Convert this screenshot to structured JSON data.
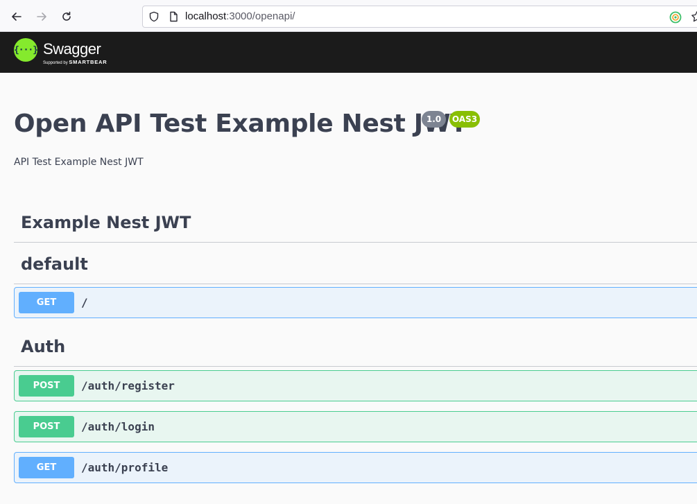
{
  "browser": {
    "url_host": "localhost",
    "url_path": ":3000/openapi/",
    "icons": [
      "back-arrow-icon",
      "forward-arrow-icon",
      "reload-icon",
      "shield-icon",
      "page-icon",
      "extension-icon",
      "bookmark-star-icon"
    ]
  },
  "topbar": {
    "logo_glyph": "{···}",
    "title": "Swagger",
    "tagline_prefix": "Supported by",
    "tagline_brand": "SMARTBEAR"
  },
  "info": {
    "title": "Open API Test Example Nest JWT",
    "version": "1.0",
    "oas": "OAS3",
    "description": "API Test Example Nest JWT"
  },
  "sections": [
    {
      "name": "Example Nest JWT",
      "operations": []
    },
    {
      "name": "default",
      "operations": [
        {
          "method": "GET",
          "path": "/"
        }
      ]
    },
    {
      "name": "Auth",
      "operations": [
        {
          "method": "POST",
          "path": "/auth/register"
        },
        {
          "method": "POST",
          "path": "/auth/login"
        },
        {
          "method": "GET",
          "path": "/auth/profile"
        }
      ]
    }
  ],
  "colors": {
    "get": "#61affe",
    "post": "#49cc90",
    "topbar": "#1b1b1b",
    "logo": "#85ea2d",
    "version_badge": "#7d8492",
    "oas_badge": "#89bf04"
  }
}
